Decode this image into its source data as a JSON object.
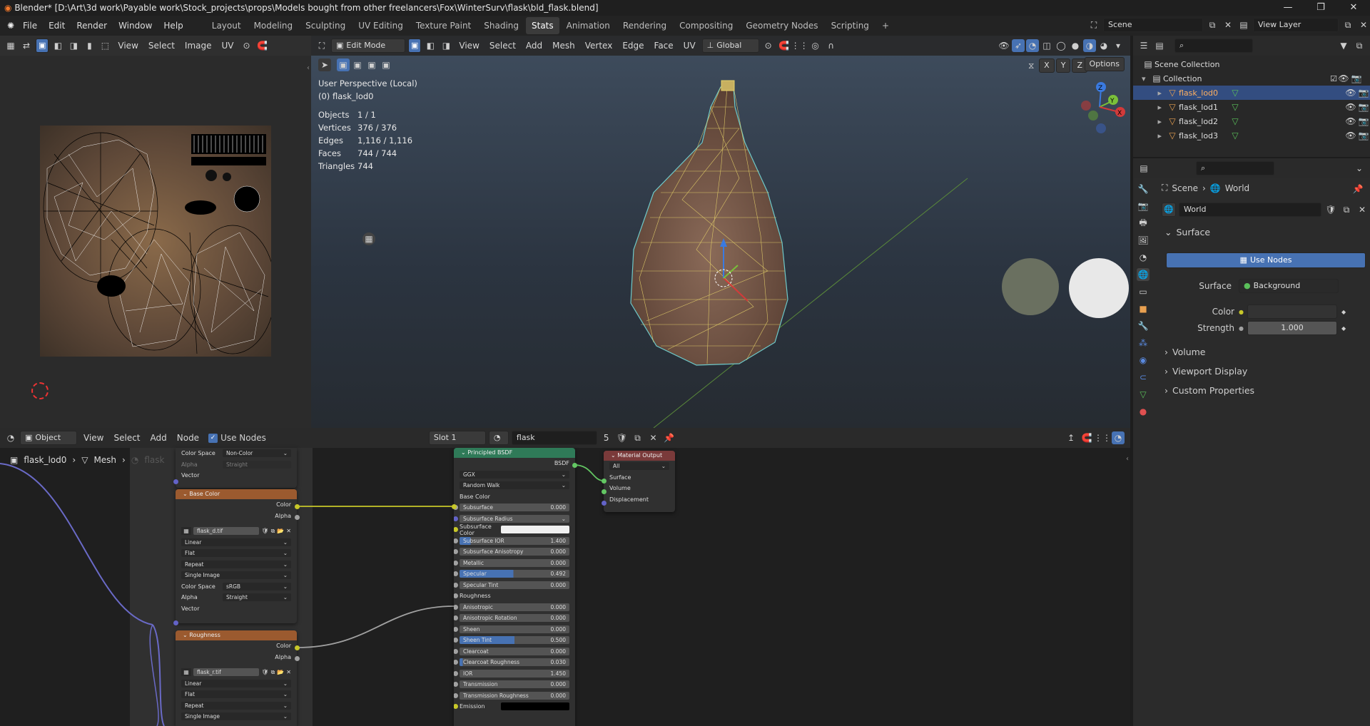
{
  "window": {
    "title": "Blender* [D:\\Art\\3d work\\Payable work\\Stock_projects\\props\\Models bought from other freelancers\\Fox\\WinterSurv\\flask\\bld_flask.blend]",
    "min": "—",
    "max": "❐",
    "close": "✕"
  },
  "menu": {
    "items": [
      "File",
      "Edit",
      "Render",
      "Window",
      "Help"
    ]
  },
  "workspaces": [
    "Layout",
    "Modeling",
    "Sculpting",
    "UV Editing",
    "Texture Paint",
    "Shading",
    "Stats",
    "Animation",
    "Rendering",
    "Compositing",
    "Geometry Nodes",
    "Scripting"
  ],
  "workspace_add": "+",
  "scene": {
    "name": "Scene",
    "view_layer": "View Layer"
  },
  "uv_header": {
    "view": "View",
    "select": "Select",
    "image": "Image",
    "uv": "UV"
  },
  "viewport_header": {
    "mode": "Edit Mode",
    "view": "View",
    "select": "Select",
    "add": "Add",
    "mesh": "Mesh",
    "vertex": "Vertex",
    "edge": "Edge",
    "face": "Face",
    "uv": "UV",
    "orientation": "Global",
    "options": "Options",
    "x": "X",
    "y": "Y",
    "z": "Z"
  },
  "viewport_info": {
    "line1": "User Perspective (Local)",
    "line2": "(0) flask_lod0",
    "stats": [
      {
        "k": "Objects",
        "v": "1 / 1"
      },
      {
        "k": "Vertices",
        "v": "376 / 376"
      },
      {
        "k": "Edges",
        "v": "1,116 / 1,116"
      },
      {
        "k": "Faces",
        "v": "744 / 744"
      },
      {
        "k": "Triangles",
        "v": "744"
      }
    ]
  },
  "gizmo": {
    "x": "X",
    "y": "Y",
    "z": "Z"
  },
  "outliner": {
    "root": "Scene Collection",
    "collection": "Collection",
    "objects": [
      "flask_lod0",
      "flask_lod1",
      "flask_lod2",
      "flask_lod3"
    ]
  },
  "properties": {
    "crumb1": "Scene",
    "crumb2": "World",
    "world_name": "World",
    "surface_panel": "Surface",
    "use_nodes": "Use Nodes",
    "surface_label": "Surface",
    "surface_value": "Background",
    "color_label": "Color",
    "strength_label": "Strength",
    "strength_value": "1.000",
    "volume": "Volume",
    "viewport_display": "Viewport Display",
    "custom_props": "Custom Properties"
  },
  "node_header": {
    "object": "Object",
    "view": "View",
    "select": "Select",
    "add": "Add",
    "node": "Node",
    "use_nodes": "Use Nodes",
    "slot": "Slot 1",
    "material": "flask",
    "users": "5"
  },
  "node_breadcrumb": {
    "obj": "flask_lod0",
    "mesh": "Mesh",
    "mat": "flask"
  },
  "nodes": {
    "top_partial": {
      "color_space_label": "Color Space",
      "color_space_value": "Non-Color",
      "alpha_label": "Alpha",
      "alpha_value": "Straight",
      "vector": "Vector"
    },
    "base_color": {
      "title": "Base Color",
      "out_color": "Color",
      "out_alpha": "Alpha",
      "image": "flask_d.tif",
      "interp": "Linear",
      "proj": "Flat",
      "ext": "Repeat",
      "source": "Single Image",
      "cs_label": "Color Space",
      "cs_value": "sRGB",
      "alpha_label": "Alpha",
      "alpha_value": "Straight",
      "vector": "Vector"
    },
    "roughness": {
      "title": "Roughness",
      "out_color": "Color",
      "out_alpha": "Alpha",
      "image": "flask_r.tif",
      "interp": "Linear",
      "proj": "Flat",
      "ext": "Repeat",
      "source": "Single Image"
    },
    "bsdf": {
      "title": "Principled BSDF",
      "out": "BSDF",
      "dist": "GGX",
      "sss": "Random Walk",
      "base_color": "Base Color",
      "rows": [
        {
          "k": "Subsurface",
          "v": "0.000"
        },
        {
          "k": "Subsurface Radius",
          "v": ""
        },
        {
          "k": "Subsurface Color",
          "v": ""
        },
        {
          "k": "Subsurface IOR",
          "v": "1.400"
        },
        {
          "k": "Subsurface Anisotropy",
          "v": "0.000"
        },
        {
          "k": "Metallic",
          "v": "0.000"
        },
        {
          "k": "Specular",
          "v": "0.492"
        },
        {
          "k": "Specular Tint",
          "v": "0.000"
        },
        {
          "k": "Roughness",
          "v": ""
        },
        {
          "k": "Anisotropic",
          "v": "0.000"
        },
        {
          "k": "Anisotropic Rotation",
          "v": "0.000"
        },
        {
          "k": "Sheen",
          "v": "0.000"
        },
        {
          "k": "Sheen Tint",
          "v": "0.500"
        },
        {
          "k": "Clearcoat",
          "v": "0.000"
        },
        {
          "k": "Clearcoat Roughness",
          "v": "0.030"
        },
        {
          "k": "IOR",
          "v": "1.450"
        },
        {
          "k": "Transmission",
          "v": "0.000"
        },
        {
          "k": "Transmission Roughness",
          "v": "0.000"
        },
        {
          "k": "Emission",
          "v": ""
        }
      ]
    },
    "output": {
      "title": "Material Output",
      "target": "All",
      "surface": "Surface",
      "volume": "Volume",
      "displacement": "Displacement"
    }
  },
  "colors": {
    "accent": "#4772b3",
    "bsdf_header": "#2f7a58",
    "output_header": "#7a3a3a",
    "tex_header": "#9b5a2f",
    "socket_yellow": "#c7c729",
    "socket_grey": "#a1a1a1",
    "socket_purple": "#6363c7",
    "socket_green": "#63c763"
  }
}
